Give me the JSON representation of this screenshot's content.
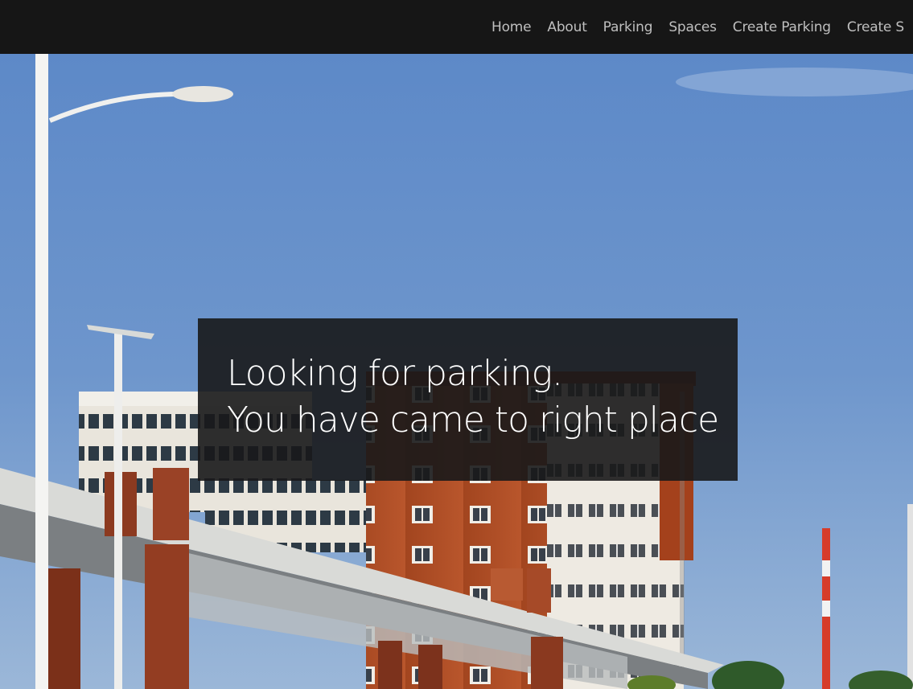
{
  "nav": {
    "items": [
      {
        "label": "Home"
      },
      {
        "label": "About"
      },
      {
        "label": "Parking"
      },
      {
        "label": "Spaces"
      },
      {
        "label": "Create Parking"
      },
      {
        "label": "Create S"
      }
    ]
  },
  "hero": {
    "image_icon": "campus-building-photo",
    "headline_line1": "Looking for parking.",
    "headline_line2": "You have came to right place"
  },
  "colors": {
    "navbar_bg": "#161616",
    "nav_text": "#bfbfbf",
    "caption_bg": "#18181a",
    "sky": "#6b93c9"
  }
}
